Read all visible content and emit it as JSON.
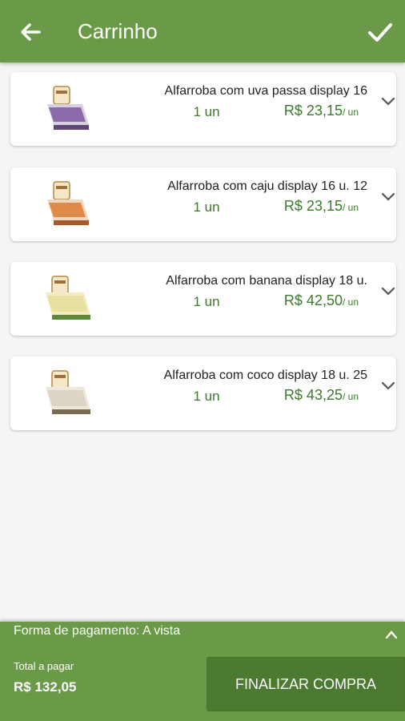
{
  "appbar": {
    "title": "Carrinho",
    "back_icon": "arrow-left-icon",
    "confirm_icon": "check-icon"
  },
  "colors": {
    "primary": "#6a9a48",
    "button": "#4b7a30",
    "price": "#3a7a2a"
  },
  "cart": {
    "items": [
      {
        "name": "Alfarroba com uva passa display 16",
        "qty": "1 un",
        "price": "R$ 23,15",
        "unit": "/ un",
        "box_color": "#8a6aa8"
      },
      {
        "name": "Alfarroba com caju display 16 u. 12",
        "qty": "1 un",
        "price": "R$ 23,15",
        "unit": "/ un",
        "box_color": "#e08a4a"
      },
      {
        "name": "Alfarroba com banana display 18 u.",
        "qty": "1 un",
        "price": "R$ 42,50",
        "unit": "/ un",
        "box_color": "#e8e0a0"
      },
      {
        "name": "Alfarroba com coco display 18 u. 25",
        "qty": "1 un",
        "price": "R$ 43,25",
        "unit": "/ un",
        "box_color": "#ddd6c8"
      }
    ]
  },
  "footer": {
    "payment_label": "Forma de pagamento: A vista",
    "total_label": "Total a pagar",
    "total_value": "R$ 132,05",
    "finish_button": "FINALIZAR COMPRA"
  }
}
